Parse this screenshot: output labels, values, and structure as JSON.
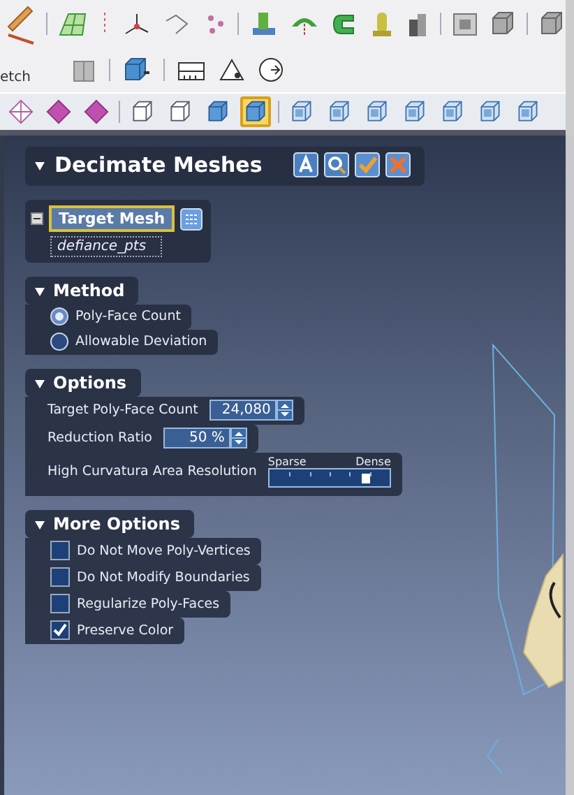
{
  "ribbon": {
    "label": "etch"
  },
  "toolbar_rows": [
    [
      {
        "kind": "pencil"
      },
      {
        "kind": "sep"
      },
      {
        "kind": "mesh"
      },
      {
        "kind": "dash"
      },
      {
        "kind": "axes"
      },
      {
        "kind": "curve"
      },
      {
        "kind": "dots"
      },
      {
        "kind": "sep"
      },
      {
        "kind": "extrude"
      },
      {
        "kind": "revolve"
      },
      {
        "kind": "sweep"
      },
      {
        "kind": "pipe"
      },
      {
        "kind": "blocks"
      },
      {
        "kind": "sep"
      },
      {
        "kind": "square"
      },
      {
        "kind": "greycube"
      },
      {
        "kind": "sep"
      },
      {
        "kind": "greycube"
      }
    ],
    [
      {
        "kind": "book"
      },
      {
        "kind": "sep"
      },
      {
        "kind": "bluecube"
      },
      {
        "kind": "sep"
      },
      {
        "kind": "ruler"
      },
      {
        "kind": "triangle"
      },
      {
        "kind": "clock"
      }
    ]
  ],
  "view_toolbar": [
    {
      "kind": "diamond-outline",
      "selected": false
    },
    {
      "kind": "diamond",
      "selected": false
    },
    {
      "kind": "diamond",
      "selected": false
    },
    {
      "kind": "wire-cube",
      "selected": false
    },
    {
      "kind": "wire-cube",
      "selected": false
    },
    {
      "kind": "shaded-cube",
      "selected": false
    },
    {
      "kind": "shaded-cube",
      "selected": true
    },
    {
      "kind": "view-cube",
      "selected": false
    },
    {
      "kind": "view-cube",
      "selected": false
    },
    {
      "kind": "view-cube",
      "selected": false
    },
    {
      "kind": "view-cube",
      "selected": false
    },
    {
      "kind": "view-cube",
      "selected": false
    },
    {
      "kind": "view-cube",
      "selected": false
    },
    {
      "kind": "view-cube",
      "selected": false
    }
  ],
  "panel": {
    "title": "Decimate Meshes",
    "header_buttons": [
      {
        "kind": "help"
      },
      {
        "kind": "preview"
      },
      {
        "kind": "ok"
      },
      {
        "kind": "cancel"
      }
    ],
    "target": {
      "label": "Target Mesh",
      "expanded": true,
      "value": "defiance_pts"
    },
    "sections": [
      {
        "title": "Method",
        "items": [
          {
            "kind": "radio",
            "label": "Poly-Face Count",
            "selected": true
          },
          {
            "kind": "radio",
            "label": "Allowable Deviation",
            "selected": false
          }
        ]
      },
      {
        "title": "Options",
        "items": [
          {
            "kind": "spinner",
            "label": "Target Poly-Face Count",
            "value": "24,080"
          },
          {
            "kind": "spinner",
            "label": "Reduction Ratio",
            "value": "50 %"
          },
          {
            "kind": "slider",
            "label": "High Curvatura Area Resolution",
            "min_label": "Sparse",
            "max_label": "Dense",
            "level": 0.8
          }
        ]
      },
      {
        "title": "More Options",
        "items": [
          {
            "kind": "checkbox",
            "label": "Do Not Move Poly-Vertices",
            "checked": false
          },
          {
            "kind": "checkbox",
            "label": "Do Not Modify Boundaries",
            "checked": false
          },
          {
            "kind": "checkbox",
            "label": "Regularize Poly-Faces",
            "checked": false
          },
          {
            "kind": "checkbox",
            "label": "Preserve Color",
            "checked": true
          }
        ]
      }
    ]
  }
}
